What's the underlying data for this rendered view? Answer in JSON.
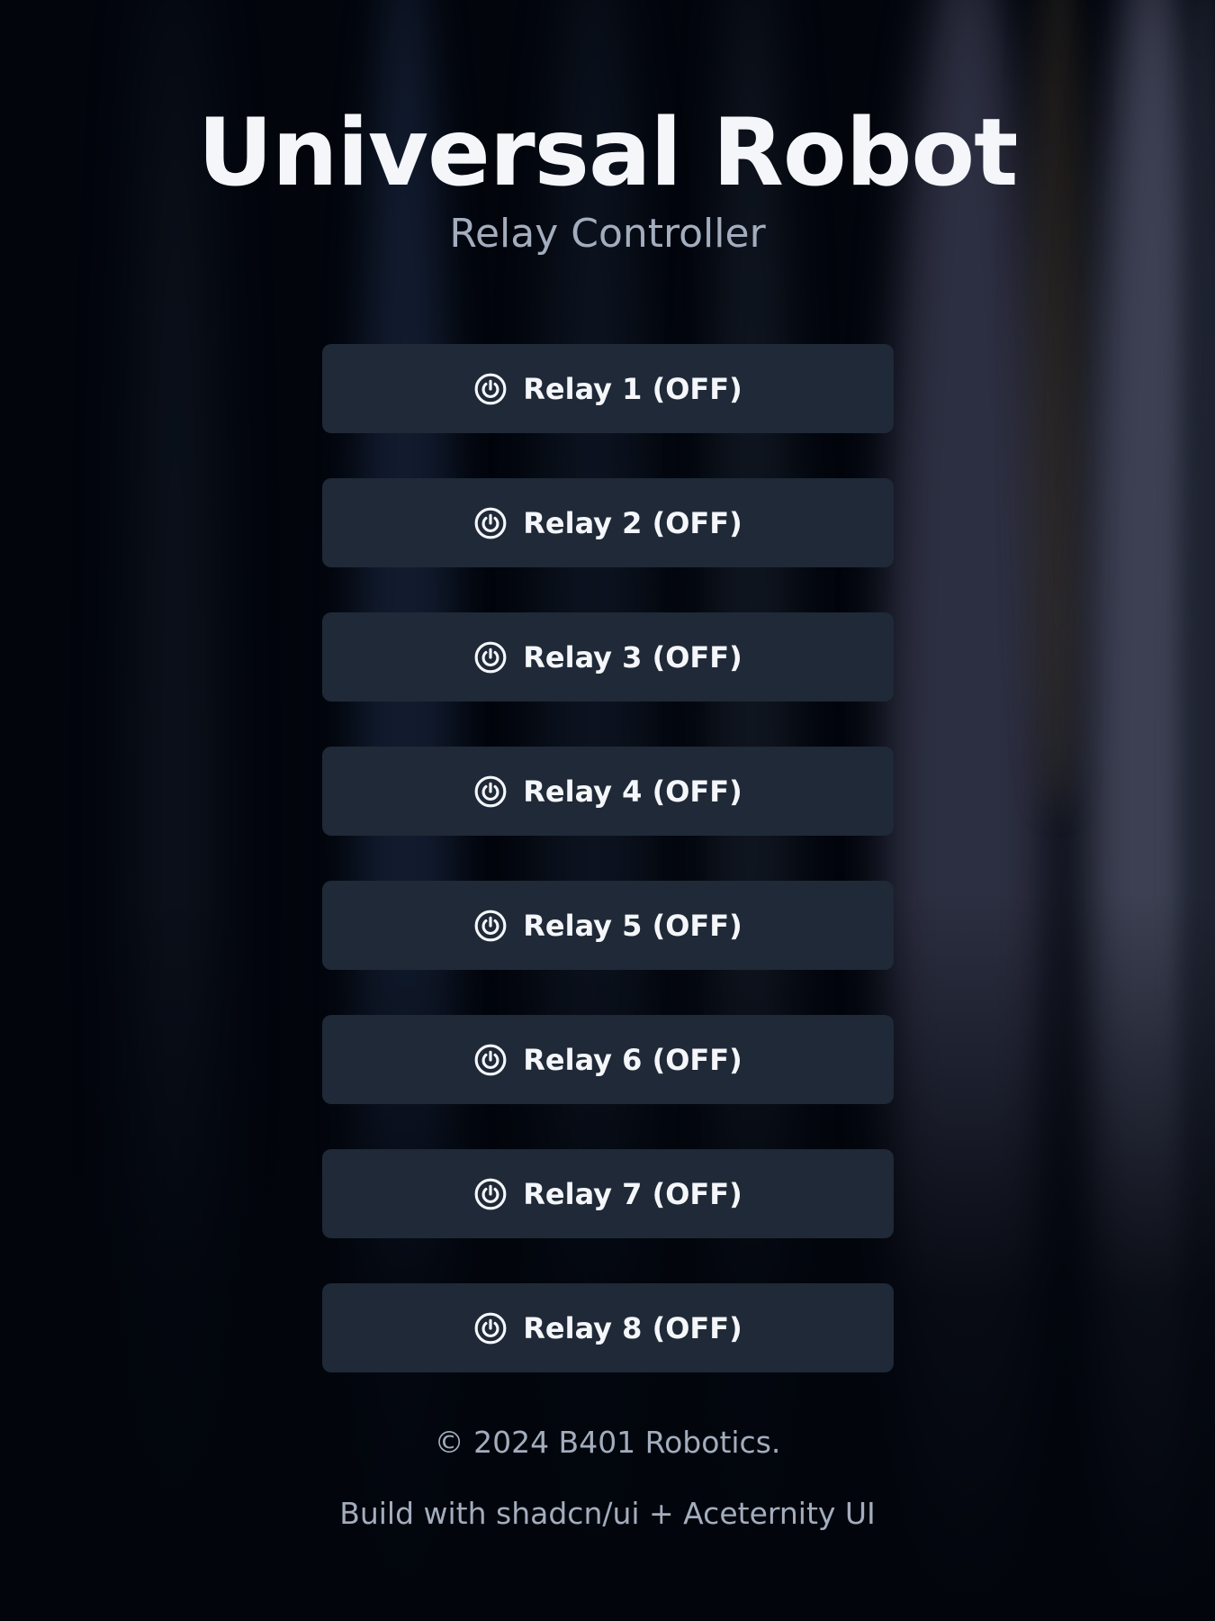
{
  "header": {
    "title": "Universal Robot",
    "subtitle": "Relay Controller"
  },
  "relays": [
    {
      "label": "Relay 1 (OFF)",
      "icon": "power-icon",
      "state": "OFF"
    },
    {
      "label": "Relay 2 (OFF)",
      "icon": "power-icon",
      "state": "OFF"
    },
    {
      "label": "Relay 3 (OFF)",
      "icon": "power-icon",
      "state": "OFF"
    },
    {
      "label": "Relay 4 (OFF)",
      "icon": "power-icon",
      "state": "OFF"
    },
    {
      "label": "Relay 5 (OFF)",
      "icon": "power-icon",
      "state": "OFF"
    },
    {
      "label": "Relay 6 (OFF)",
      "icon": "power-icon",
      "state": "OFF"
    },
    {
      "label": "Relay 7 (OFF)",
      "icon": "power-icon",
      "state": "OFF"
    },
    {
      "label": "Relay 8 (OFF)",
      "icon": "power-icon",
      "state": "OFF"
    }
  ],
  "footer": {
    "copyright": "© 2024 B401 Robotics.",
    "credits": "Build with shadcn/ui + Aceternity UI"
  },
  "colors": {
    "background": "#02050c",
    "button_background": "#1f2937",
    "title": "#f4f6fa",
    "muted_text": "#a3adbd"
  }
}
